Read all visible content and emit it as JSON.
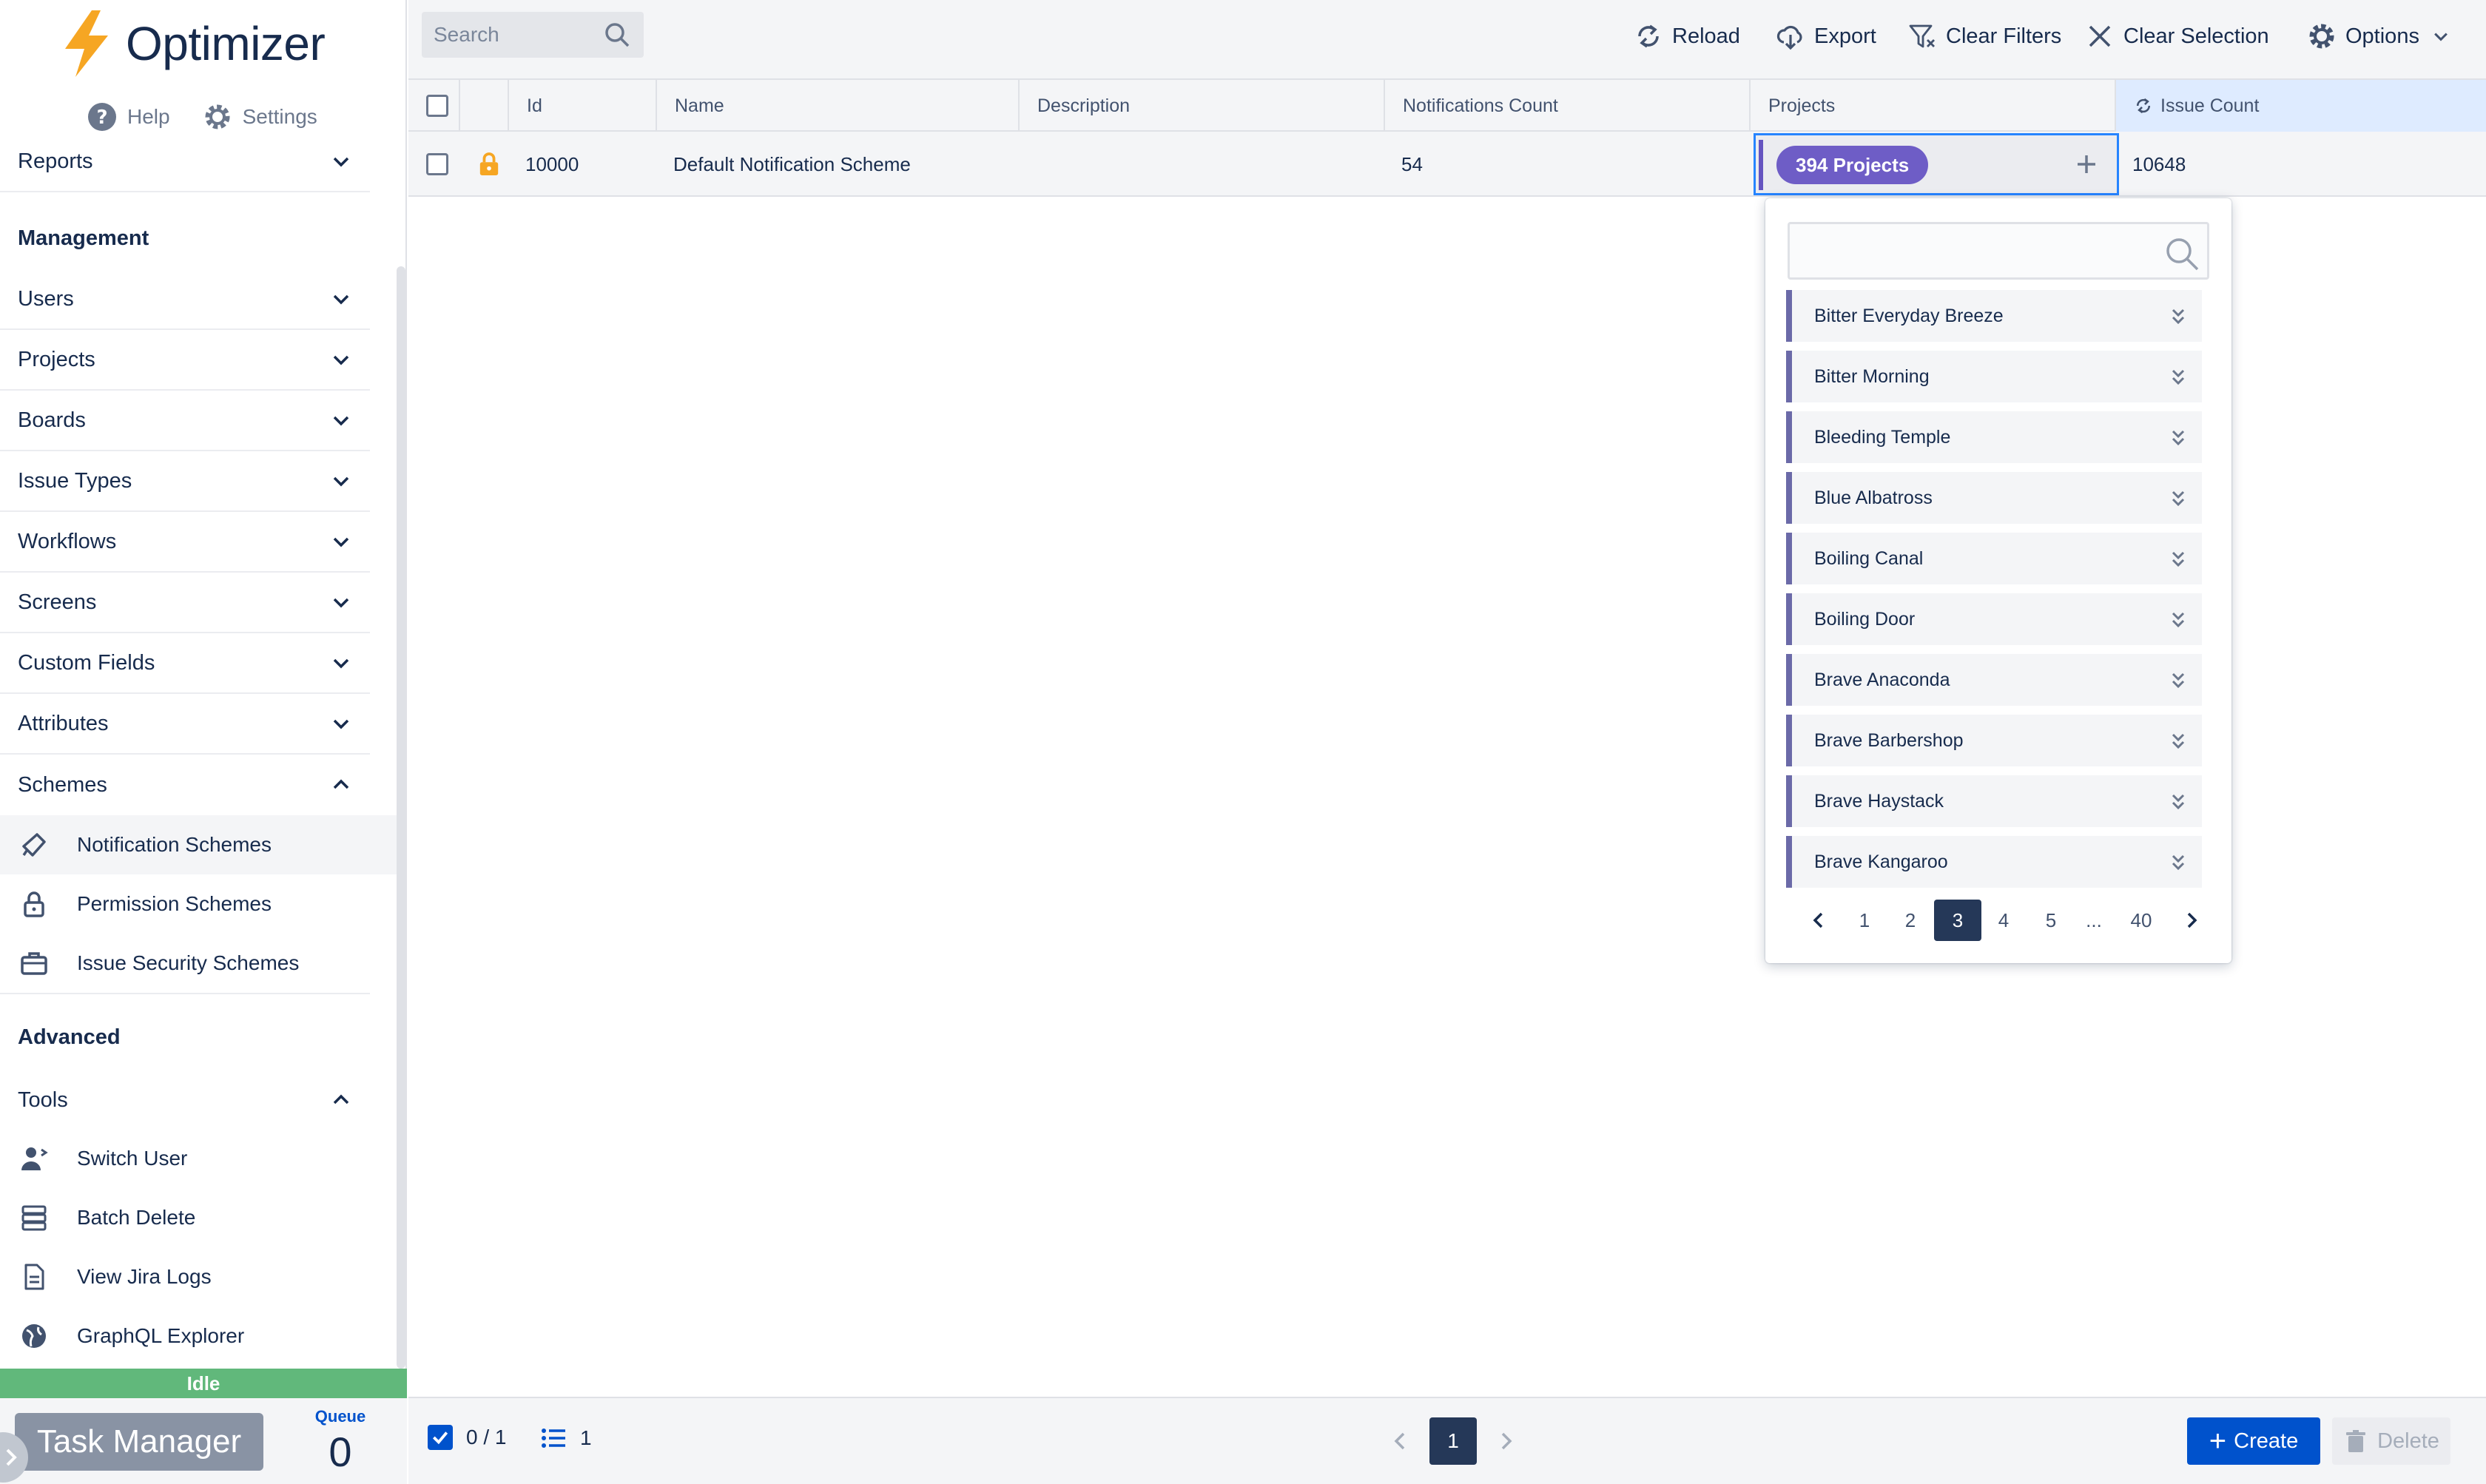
{
  "app": {
    "name": "Optimizer"
  },
  "top_links": {
    "help": "Help",
    "settings": "Settings"
  },
  "nav": {
    "reports": "Reports",
    "management_heading": "Management",
    "management_items": [
      "Users",
      "Projects",
      "Boards",
      "Issue Types",
      "Workflows",
      "Screens",
      "Custom Fields",
      "Attributes",
      "Schemes"
    ],
    "schemes_subitems": [
      "Notification Schemes",
      "Permission Schemes",
      "Issue Security Schemes"
    ],
    "advanced_heading": "Advanced",
    "tools": "Tools",
    "tools_subitems": [
      "Switch User",
      "Batch Delete",
      "View Jira Logs",
      "GraphQL Explorer"
    ]
  },
  "status": {
    "state": "Idle",
    "task_manager": "Task Manager",
    "queue_label": "Queue",
    "queue_value": "0"
  },
  "toolbar": {
    "search_placeholder": "Search",
    "reload": "Reload",
    "export": "Export",
    "clear_filters": "Clear Filters",
    "clear_selection": "Clear Selection",
    "options": "Options"
  },
  "grid": {
    "columns": [
      "Id",
      "Name",
      "Description",
      "Notifications Count",
      "Projects",
      "Issue Count"
    ],
    "rows": [
      {
        "id": "10000",
        "name": "Default Notification Scheme",
        "description": "",
        "notifications_count": "54",
        "projects": "394 Projects",
        "issue_count": "10648"
      }
    ]
  },
  "dropdown": {
    "search_value": "",
    "items": [
      "Bitter Everyday Breeze",
      "Bitter Morning",
      "Bleeding Temple",
      "Blue Albatross",
      "Boiling Canal",
      "Boiling Door",
      "Brave Anaconda",
      "Brave Barbershop",
      "Brave Haystack",
      "Brave Kangaroo"
    ],
    "pages": [
      "1",
      "2",
      "3",
      "4",
      "5",
      "...",
      "40"
    ],
    "current_page": "3"
  },
  "footer": {
    "selected": "0 / 1",
    "row_count": "1",
    "page": "1",
    "create": "Create",
    "delete": "Delete"
  },
  "colors": {
    "primary": "#0052cc",
    "project_badge": "#6e5dc6",
    "status_idle": "#61b87b",
    "logo_bolt": "#f6a623"
  },
  "icons": [
    "bolt-logo-icon",
    "help-icon",
    "gear-icon",
    "chevron-down-icon",
    "chevron-up-icon",
    "megaphone-icon",
    "lock-icon",
    "suitcase-icon",
    "switch-user-icon",
    "batch-delete-icon",
    "document-icon",
    "globe-icon",
    "search-icon",
    "reload-icon",
    "cloud-download-icon",
    "filter-clear-icon",
    "close-icon",
    "plus-icon",
    "double-chevron-icon",
    "chevron-left-icon",
    "chevron-right-icon",
    "list-icon",
    "trash-icon",
    "check-icon"
  ]
}
